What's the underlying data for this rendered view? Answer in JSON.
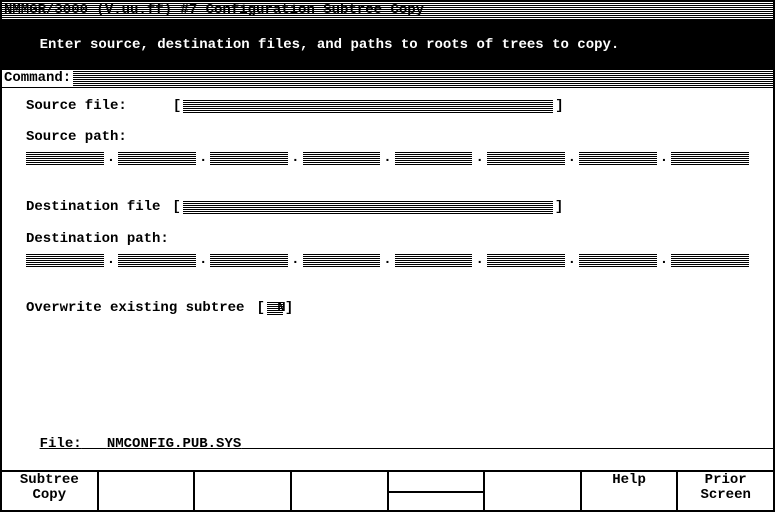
{
  "header": {
    "title": "NMMGR/3000 (V.uu.ff) #7  Configuration Subtree Copy",
    "instruction": "Enter source, destination files, and paths to roots of trees to copy.",
    "command_label": "Command:"
  },
  "form": {
    "source_file_label": "Source file:",
    "source_file_value": "",
    "source_path_label": "Source path:",
    "source_path_segments": [
      "",
      "",
      "",
      "",
      "",
      "",
      "",
      ""
    ],
    "dest_file_label": "Destination file",
    "dest_file_value": "",
    "dest_path_label": "Destination path:",
    "dest_path_segments": [
      "",
      "",
      "",
      "",
      "",
      "",
      "",
      ""
    ],
    "overwrite_label": "Overwrite existing subtree",
    "overwrite_value": "N"
  },
  "footer": {
    "file_label": "File:",
    "file_value": "NMCONFIG.PUB.SYS"
  },
  "fkeys": {
    "f1_line1": "Subtree",
    "f1_line2": "Copy",
    "f2": "",
    "f3": "",
    "f4": "",
    "f5": "",
    "f6": "",
    "f7": "Help",
    "f8_line1": "Prior",
    "f8_line2": "Screen"
  }
}
